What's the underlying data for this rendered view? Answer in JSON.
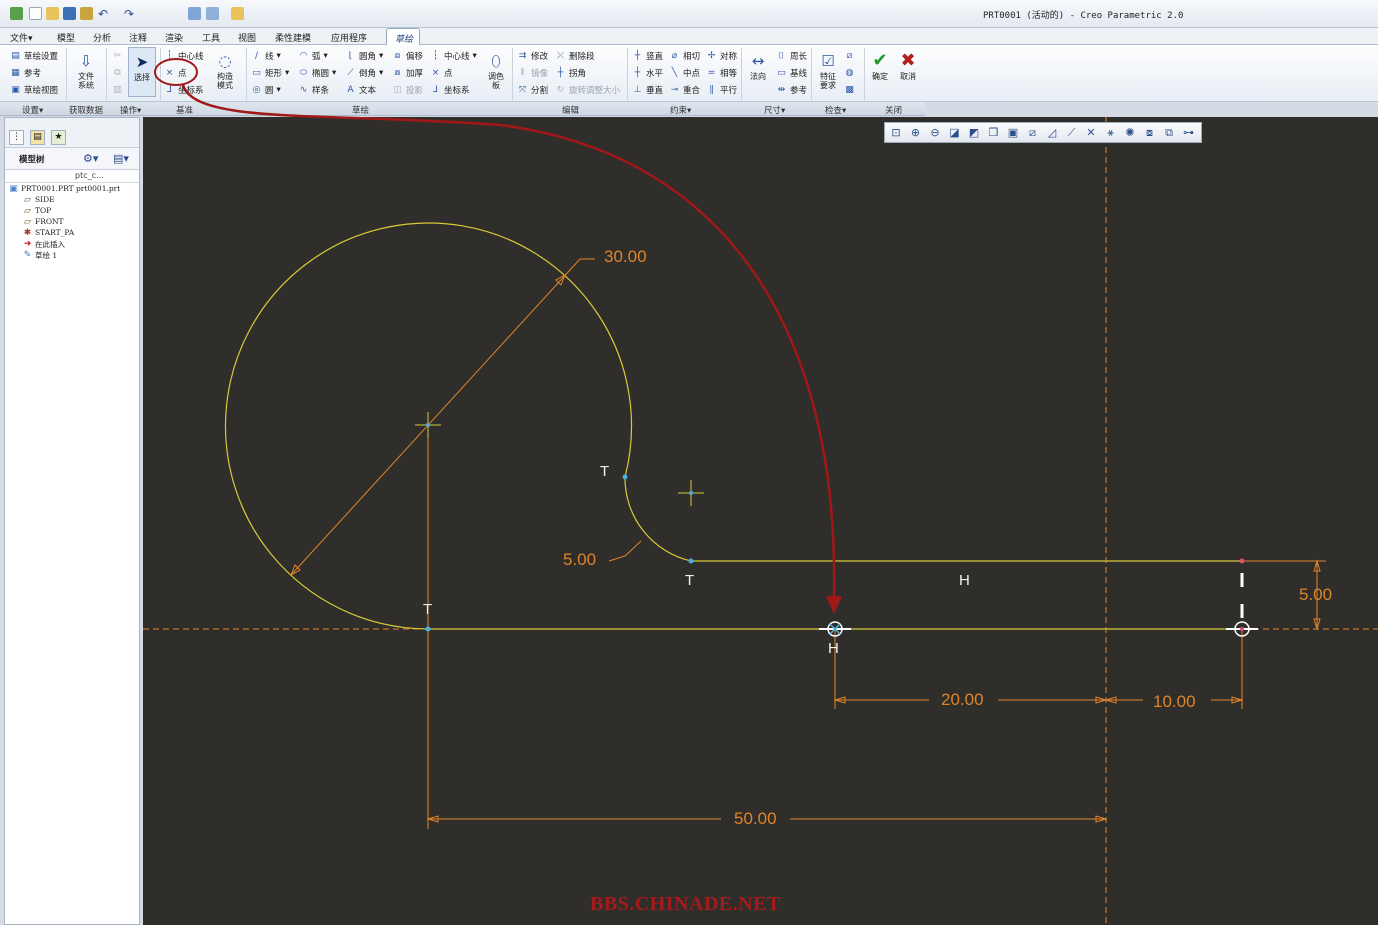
{
  "window": {
    "title": "PRT0001 (活动的) - Creo Parametric 2.0"
  },
  "menus": [
    "文件▾",
    "模型",
    "分析",
    "注释",
    "渲染",
    "工具",
    "视图",
    "柔性建模",
    "应用程序"
  ],
  "active_tab": "草绘",
  "ribbon": {
    "setup": [
      "草绘设置",
      "参考",
      "草绘视图"
    ],
    "file_system": "文件\n系统",
    "select": "选择",
    "datum": [
      "中心线",
      "点",
      "坐标系"
    ],
    "construction": "构造\n模式",
    "sketch_col1": [
      "线",
      "矩形",
      "圆"
    ],
    "sketch_col2": [
      "弧",
      "椭圆",
      "样条"
    ],
    "sketch_col3": [
      "圆角",
      "倒角",
      "文本"
    ],
    "sketch_col4": [
      "偏移",
      "加厚",
      "投影"
    ],
    "sketch_col5": [
      "中心线",
      "点",
      "坐标系"
    ],
    "palette": "调色\n板",
    "edit_col1": [
      "修改",
      "镜像",
      "分割"
    ],
    "edit_col2": [
      "删除段",
      "拐角",
      "旋转调整大小"
    ],
    "constrain_col1": [
      "竖直",
      "水平",
      "垂直"
    ],
    "constrain_col2": [
      "相切",
      "中点",
      "重合"
    ],
    "constrain_col3": [
      "对称",
      "相等",
      "平行"
    ],
    "dim_normal": "法向",
    "dim_col": [
      "周长",
      "基线",
      "参考"
    ],
    "inspect": "特征\n要求",
    "ok": "确定",
    "cancel": "取消",
    "groups": [
      "设置▾",
      "获取数据",
      "操作▾",
      "基准",
      "草绘",
      "编辑",
      "约束▾",
      "尺寸▾",
      "检查▾",
      "关闭"
    ]
  },
  "model_tree": {
    "title": "模型树",
    "column": "ptc_c...",
    "items": [
      "PRT0001.PRT  prt0001.prt",
      "SIDE",
      "TOP",
      "FRONT",
      "START_PA",
      "在此插入",
      "草绘 1"
    ]
  },
  "sketch": {
    "dimensions": [
      "30.00",
      "5.00",
      "5.00",
      "20.00",
      "10.00",
      "50.00"
    ],
    "constraints": [
      "T",
      "T",
      "T",
      "H",
      "H"
    ]
  },
  "colors": {
    "canvas": "#2f2e2a",
    "geometry": "#d8c93a",
    "dimension": "#e0842a",
    "annotation": "#a01818"
  },
  "watermark": "BBS.CHINADE.NET"
}
